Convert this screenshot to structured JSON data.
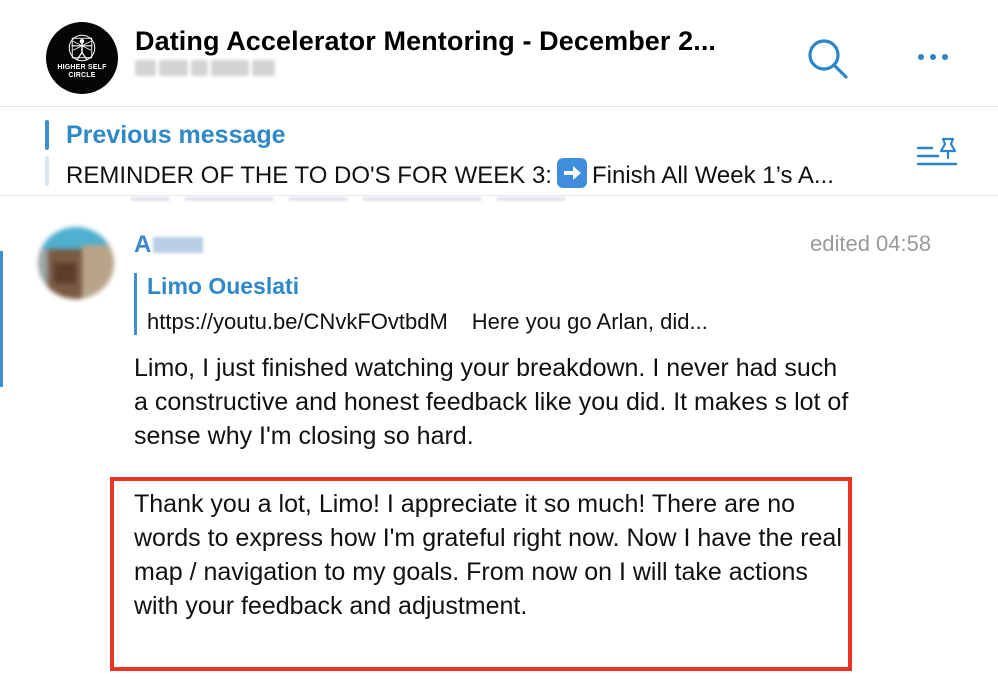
{
  "header": {
    "logo_text_line1": "HIGHER SELF",
    "logo_text_line2": "CIRCLE",
    "title": "Dating Accelerator Mentoring - December 2...",
    "search_icon": "search-icon",
    "more_icon": "more-options-icon"
  },
  "pinned": {
    "label": "Previous message",
    "text_before": "REMINDER OF THE TO DO'S FOR WEEK 3:",
    "emoji": "right-arrow-emoji",
    "text_after": "Finish All Week 1’s A...",
    "list_icon": "pinned-list-icon"
  },
  "message": {
    "sender_name_visible": "A",
    "meta": "edited  04:58",
    "reply": {
      "author": "Limo Oueslati",
      "url": "https://youtu.be/CNvkFOvtbdM",
      "text": "Here you go Arlan, did..."
    },
    "body_paragraph_1": "Limo, I just finished watching your breakdown. I never had such a constructive and honest feedback like you did. It makes s lot of sense why I'm closing so hard.",
    "body_paragraph_2": "Thank you a lot, Limo! I appreciate it so much! There are no words to express how I'm grateful right now. Now I have the real map / navigation to my goals. From now on I will take actions with your feedback and adjustment."
  },
  "colors": {
    "accent": "#2f89c8",
    "highlight_border": "#ea3323",
    "meta_text": "#9a9a9a"
  }
}
